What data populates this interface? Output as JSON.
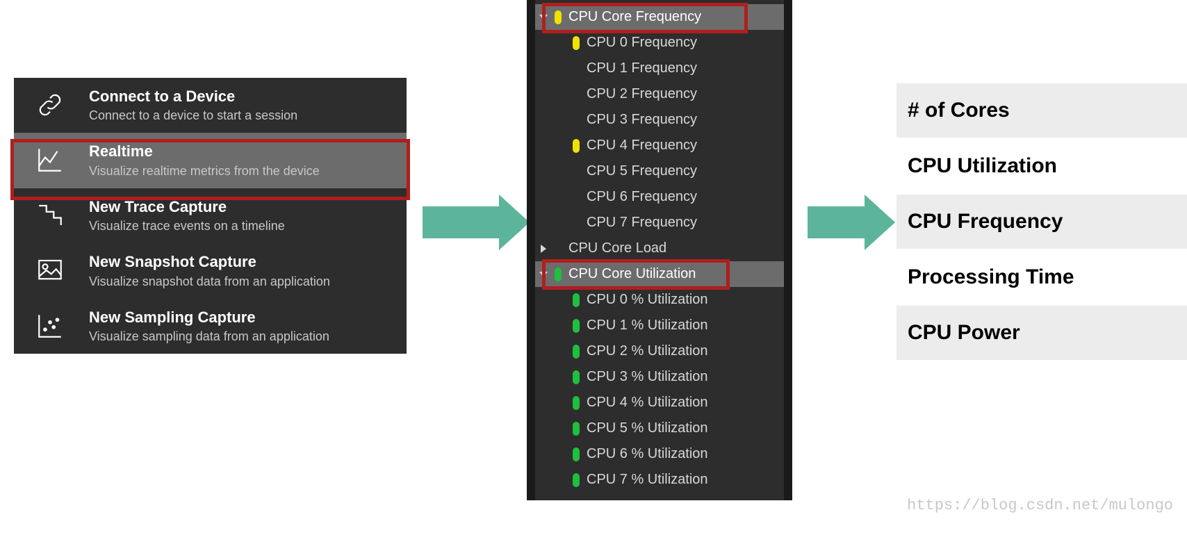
{
  "menu": [
    {
      "id": "connect",
      "title": "Connect to a Device",
      "subtitle": "Connect to a device to start a session",
      "icon": "link-icon",
      "selected": false
    },
    {
      "id": "realtime",
      "title": "Realtime",
      "subtitle": "Visualize realtime metrics from the device",
      "icon": "chart-icon",
      "selected": true
    },
    {
      "id": "trace",
      "title": "New Trace Capture",
      "subtitle": "Visualize trace events on a timeline",
      "icon": "stairs-icon",
      "selected": false
    },
    {
      "id": "snapshot",
      "title": "New Snapshot Capture",
      "subtitle": "Visualize snapshot data from an application",
      "icon": "image-icon",
      "selected": false
    },
    {
      "id": "sampling",
      "title": "New Sampling Capture",
      "subtitle": "Visualize sampling data from an application",
      "icon": "scatter-icon",
      "selected": false
    }
  ],
  "tree": [
    {
      "kind": "parent",
      "state": "expanded",
      "marker": "yellow",
      "label": "CPU Core Frequency",
      "selected": true
    },
    {
      "kind": "child",
      "marker": "yellow",
      "label": "CPU 0 Frequency"
    },
    {
      "kind": "child",
      "marker": "none",
      "label": "CPU 1 Frequency"
    },
    {
      "kind": "child",
      "marker": "none",
      "label": "CPU 2 Frequency"
    },
    {
      "kind": "child",
      "marker": "none",
      "label": "CPU 3 Frequency"
    },
    {
      "kind": "child",
      "marker": "yellow",
      "label": "CPU 4 Frequency"
    },
    {
      "kind": "child",
      "marker": "none",
      "label": "CPU 5 Frequency"
    },
    {
      "kind": "child",
      "marker": "none",
      "label": "CPU 6 Frequency"
    },
    {
      "kind": "child",
      "marker": "none",
      "label": "CPU 7 Frequency"
    },
    {
      "kind": "parent",
      "state": "collapsed",
      "marker": "none",
      "label": "CPU Core Load"
    },
    {
      "kind": "parent",
      "state": "expanded",
      "marker": "green",
      "label": "CPU Core Utilization",
      "selected": true
    },
    {
      "kind": "child",
      "marker": "green",
      "label": "CPU 0 % Utilization"
    },
    {
      "kind": "child",
      "marker": "green",
      "label": "CPU 1 % Utilization"
    },
    {
      "kind": "child",
      "marker": "green",
      "label": "CPU 2 % Utilization"
    },
    {
      "kind": "child",
      "marker": "green",
      "label": "CPU 3 % Utilization"
    },
    {
      "kind": "child",
      "marker": "green",
      "label": "CPU 4 % Utilization"
    },
    {
      "kind": "child",
      "marker": "green",
      "label": "CPU 5 % Utilization"
    },
    {
      "kind": "child",
      "marker": "green",
      "label": "CPU 6 % Utilization"
    },
    {
      "kind": "child",
      "marker": "green",
      "label": "CPU 7 % Utilization"
    }
  ],
  "right": [
    {
      "label": "# of Cores",
      "alt": true
    },
    {
      "label": "CPU Utilization",
      "alt": false
    },
    {
      "label": "CPU Frequency",
      "alt": true
    },
    {
      "label": "Processing Time",
      "alt": false
    },
    {
      "label": "CPU Power",
      "alt": true
    }
  ],
  "highlight_color": "#b01e1e",
  "arrow_color": "#5cb59a",
  "watermark": "https://blog.csdn.net/mulongo"
}
